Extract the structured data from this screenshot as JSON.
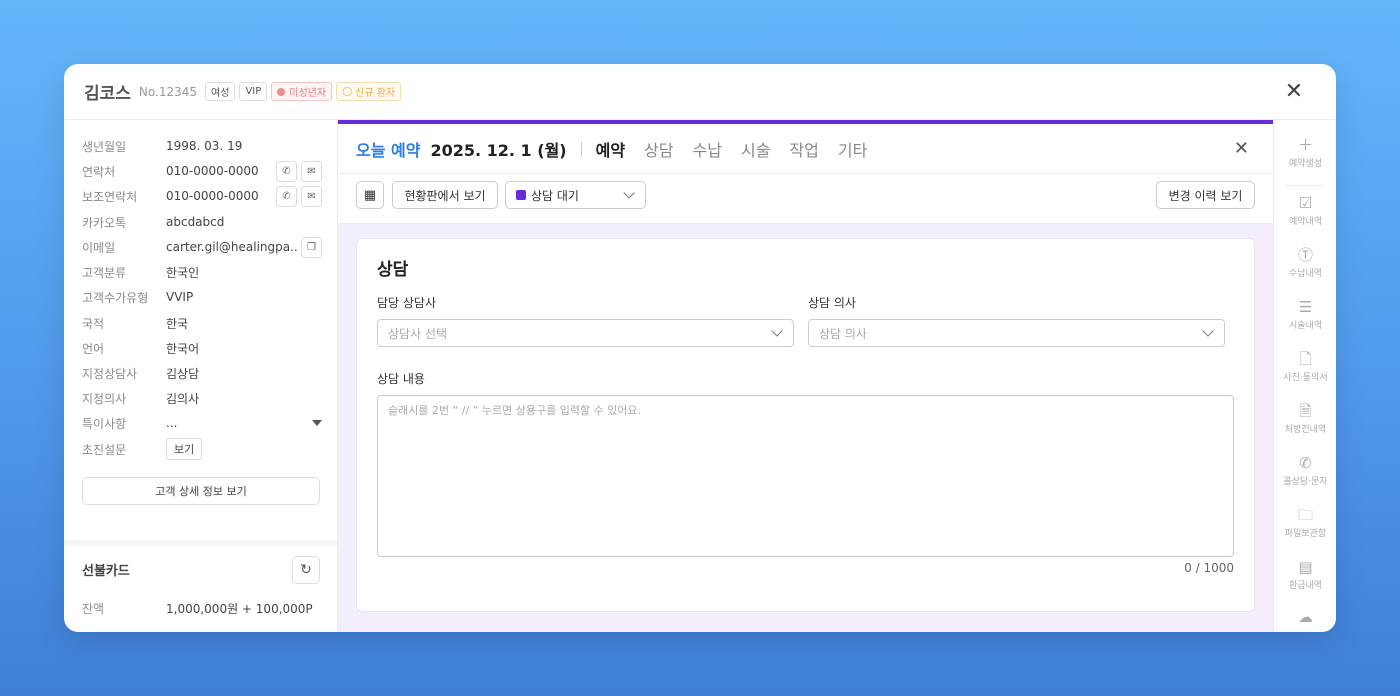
{
  "customer": {
    "name": "김코스",
    "number": "No.12345",
    "tags": {
      "gender": "여성",
      "grade": "VIP",
      "minor": "미성년자",
      "new": "신규 환자"
    }
  },
  "info": [
    {
      "label": "생년월일",
      "value": "1998. 03. 19"
    },
    {
      "label": "연락처",
      "value": "010-0000-0000"
    },
    {
      "label": "보조연락처",
      "value": "010-0000-0000"
    },
    {
      "label": "카카오톡",
      "value": "abcdabcd"
    },
    {
      "label": "이메일",
      "value": "carter.gil@healingpa..."
    },
    {
      "label": "고객분류",
      "value": "한국인"
    },
    {
      "label": "고객수가유형",
      "value": "VVIP"
    },
    {
      "label": "국적",
      "value": "한국"
    },
    {
      "label": "언어",
      "value": "한국어"
    },
    {
      "label": "지정상담사",
      "value": "김상담"
    },
    {
      "label": "지정의사",
      "value": "김의사"
    },
    {
      "label": "특이사항",
      "value": "..."
    },
    {
      "label": "초진설문",
      "value": "보기"
    }
  ],
  "detail_button": "고객 상세 정보 보기",
  "prepaid": {
    "title": "선불카드",
    "balance_label": "잔액",
    "balance_value": "1,000,000원 + 100,000P"
  },
  "appointment": {
    "today_label": "오늘 예약",
    "date": "2025. 12. 1 (월)",
    "tabs": [
      "예약",
      "상담",
      "수납",
      "시술",
      "작업",
      "기타"
    ],
    "active_tab": "예약"
  },
  "toolbar": {
    "board_button": "현황판에서 보기",
    "status_value": "상담 대기",
    "status_color": "#6a2cd6",
    "history_button": "변경 이력 보기"
  },
  "consult": {
    "title": "상담",
    "counselor_label": "담당 상담사",
    "counselor_placeholder": "상담사 선택",
    "doctor_label": "상담 의사",
    "doctor_placeholder": "상담 의사",
    "content_label": "상담 내용",
    "content_placeholder": "슬래시를 2번 “ // ” 누르면 상용구를 입력할 수 있어요.",
    "counter": "0 / 1000"
  },
  "sidebar": [
    {
      "label": "예약생성",
      "icon": "plus-icon"
    },
    {
      "label": "예약내역",
      "icon": "calendar-check-icon"
    },
    {
      "label": "수납내역",
      "icon": "dollar-icon"
    },
    {
      "label": "시술내역",
      "icon": "list-icon"
    },
    {
      "label": "사진·동의서",
      "icon": "document-icon"
    },
    {
      "label": "처방전내역",
      "icon": "prescription-icon"
    },
    {
      "label": "콜상담·문자",
      "icon": "phone-icon"
    },
    {
      "label": "파일보관함",
      "icon": "folder-icon"
    },
    {
      "label": "환급내역",
      "icon": "receipt-icon"
    },
    {
      "label": "",
      "icon": "cloud-upload-icon"
    }
  ],
  "colors": {
    "accent": "#6a2cd6",
    "link": "#2a7be4",
    "panel_bg": "#f4eefc"
  }
}
